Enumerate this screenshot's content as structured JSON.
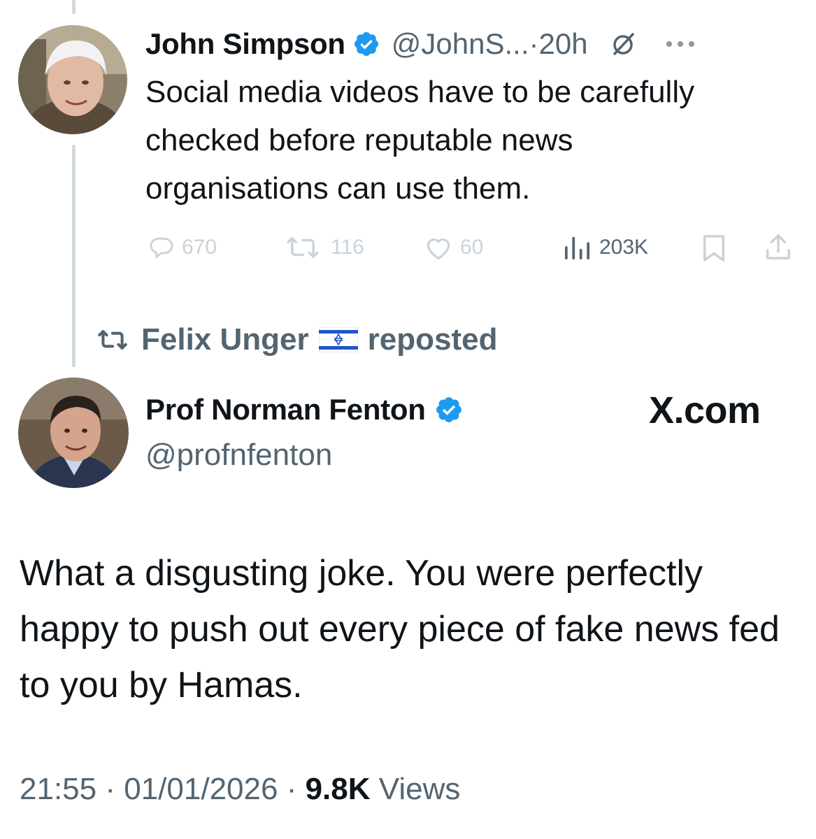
{
  "quoted_tweet": {
    "author_name": "John Simpson",
    "handle": "@JohnS...",
    "separator": "·",
    "time": "20h",
    "text": "Social media videos have to be carefully checked before reputable news organisations can use them.",
    "actions": {
      "replies": "670",
      "reposts": "116",
      "likes": "60",
      "views": "203K"
    }
  },
  "repost_banner": {
    "user": "Felix Unger",
    "label": "reposted"
  },
  "main_tweet": {
    "author_name": "Prof Norman Fenton",
    "handle": "@profnfenton",
    "site_label": "X.com",
    "text": "What a disgusting joke. You were perfectly happy to push out every piece of fake news fed to you by Hamas.",
    "footer": {
      "time": "21:55",
      "date": "01/01/2026",
      "separator": "·",
      "views_count": "9.8K",
      "views_label": "Views"
    }
  },
  "colors": {
    "verified_blue": "#1d9bf0",
    "muted": "#536471",
    "faint_icon": "#c9d2d9",
    "thread_line": "#cfd9de"
  },
  "icons": [
    "verified-badge-icon",
    "grok-icon",
    "more-icon",
    "reply-icon",
    "repost-icon",
    "like-icon",
    "views-icon",
    "bookmark-icon",
    "share-icon",
    "israel-flag-icon"
  ]
}
